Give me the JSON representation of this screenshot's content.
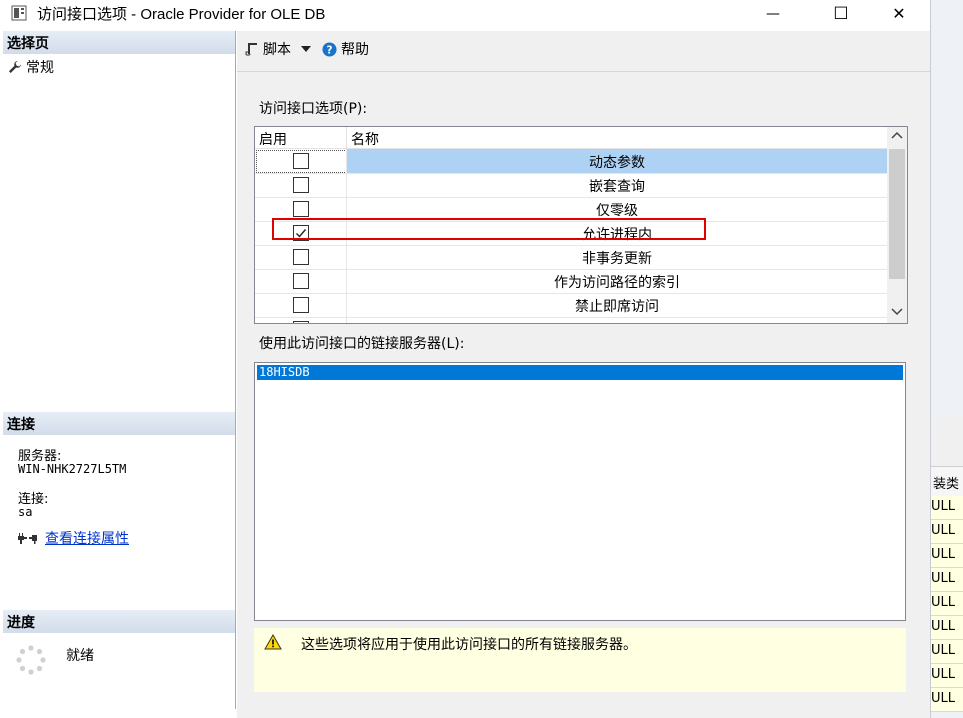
{
  "window": {
    "title": "访问接口选项 - Oracle Provider for OLE DB",
    "minimize_glyph": "—",
    "maximize_glyph": "☐",
    "close_glyph": "✕"
  },
  "left_panel": {
    "select_page_header": "选择页",
    "pages": [
      {
        "label": "常规",
        "icon": "wrench-icon"
      }
    ],
    "connection_header": "连接",
    "server_label": "服务器:",
    "server_value": "WIN-NHK2727L5TM",
    "connection_label": "连接:",
    "connection_value": "sa",
    "view_connection_link": "查看连接属性",
    "progress_header": "进度",
    "progress_status": "就绪"
  },
  "toolbar": {
    "script_label": "脚本",
    "help_label": "帮助"
  },
  "options": {
    "label": "访问接口选项(P):",
    "columns": [
      "启用",
      "名称"
    ],
    "rows": [
      {
        "enabled": false,
        "name": "动态参数",
        "selected": true
      },
      {
        "enabled": false,
        "name": "嵌套查询"
      },
      {
        "enabled": false,
        "name": "仅零级"
      },
      {
        "enabled": true,
        "name": "允许进程内",
        "highlighted": true
      },
      {
        "enabled": false,
        "name": "非事务更新"
      },
      {
        "enabled": false,
        "name": "作为访问路径的索引"
      },
      {
        "enabled": false,
        "name": "禁止即席访问"
      }
    ]
  },
  "linked_servers": {
    "label": "使用此访问接口的链接服务器(L):",
    "items": [
      "18HISDB"
    ]
  },
  "warning": {
    "text": "这些选项将应用于使用此访问接口的所有链接服务器。"
  },
  "behind_window": {
    "header": "装类",
    "cells": [
      "ULL",
      "ULL",
      "ULL",
      "ULL",
      "ULL",
      "ULL",
      "ULL",
      "ULL",
      "ULL"
    ]
  },
  "colors": {
    "accent": "#0078d7",
    "selection_row": "#aed2f3",
    "highlight_box": "#e00000",
    "warning_bg": "#ffffe1",
    "link": "#0033cc"
  }
}
